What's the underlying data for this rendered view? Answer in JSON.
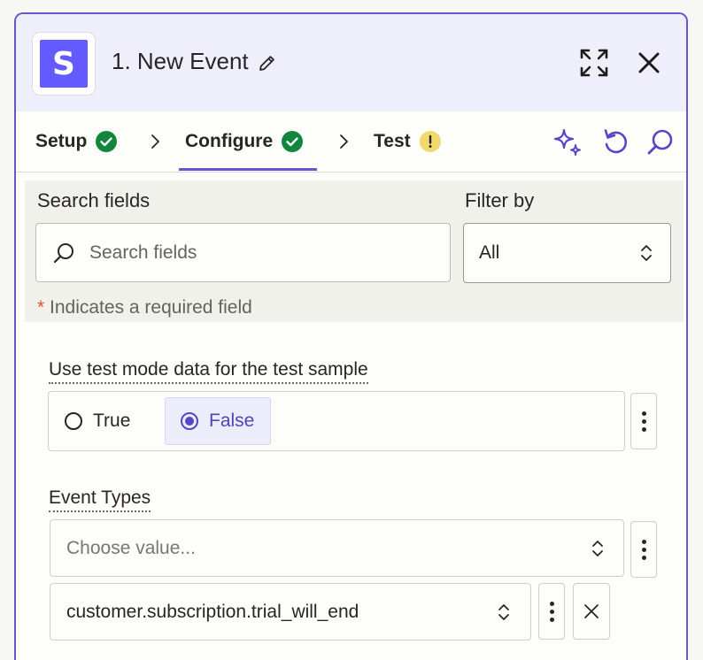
{
  "header": {
    "app_logo_letter": "S",
    "step_title": "1. New Event"
  },
  "tabs": [
    {
      "label": "Setup",
      "status": "complete"
    },
    {
      "label": "Configure",
      "status": "complete",
      "active": true
    },
    {
      "label": "Test",
      "status": "warning"
    }
  ],
  "filter": {
    "search_label": "Search fields",
    "search_placeholder": "Search fields",
    "filter_label": "Filter by",
    "filter_value": "All",
    "required_star": "*",
    "required_note": " Indicates a required field"
  },
  "fields": {
    "test_mode": {
      "label": "Use test mode data for the test sample",
      "options": [
        "True",
        "False"
      ],
      "selected": "False"
    },
    "event_types": {
      "label": "Event Types",
      "placeholder": "Choose value...",
      "values": [
        "customer.subscription.trial_will_end"
      ]
    }
  },
  "colors": {
    "accent": "#6558c9",
    "success": "#14853d",
    "warning": "#f2d96b",
    "stripe": "#635bff",
    "header_bg": "#efeffb"
  }
}
